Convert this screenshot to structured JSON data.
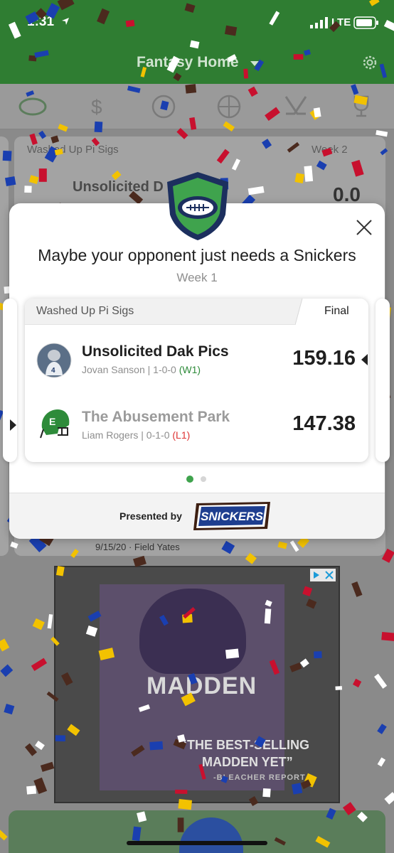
{
  "status_bar": {
    "time": "1:31",
    "network": "LTE"
  },
  "header": {
    "title": "Fantasy Home"
  },
  "sport_tabs": [
    {
      "icon": "football-icon"
    },
    {
      "icon": "money-icon"
    },
    {
      "icon": "baseball-icon"
    },
    {
      "icon": "basketball-icon"
    },
    {
      "icon": "hockey-icon"
    },
    {
      "icon": "trophy-icon"
    }
  ],
  "background": {
    "card_league": "Washed Up Pi Sigs",
    "card_week": "Week 2",
    "card_team": "Unsolicited D",
    "card_score": "0.0",
    "article_meta": "9/15/20 · Field Yates"
  },
  "modal": {
    "title": "Maybe your opponent just needs a Snickers",
    "week": "Week 1",
    "league": "Washed Up Pi Sigs",
    "status": "Final",
    "teams": [
      {
        "name": "Unsolicited Dak Pics",
        "owner": "Jovan Sanson",
        "record": "| 1-0-0",
        "result": "(W1)",
        "score": "159.16"
      },
      {
        "name": "The Abusement Park",
        "owner": "Liam Rogers",
        "record": "| 0-1-0",
        "result": "(L1)",
        "score": "147.38"
      }
    ],
    "pager": {
      "total": 2,
      "active": 1
    },
    "presented_by": "Presented by",
    "sponsor": "SNICKERS"
  },
  "ad": {
    "title": "MADDEN",
    "quote_line1": "“THE BEST-SELLING",
    "quote_line2": "MADDEN YET”",
    "quote_source": "-BLEACHER REPORT"
  },
  "colors": {
    "header_green": "#2f7d32",
    "win_green": "#2e8b3a",
    "loss_red": "#dd3333",
    "logo_navy": "#1c2f5e",
    "logo_green": "#3fa34d"
  }
}
